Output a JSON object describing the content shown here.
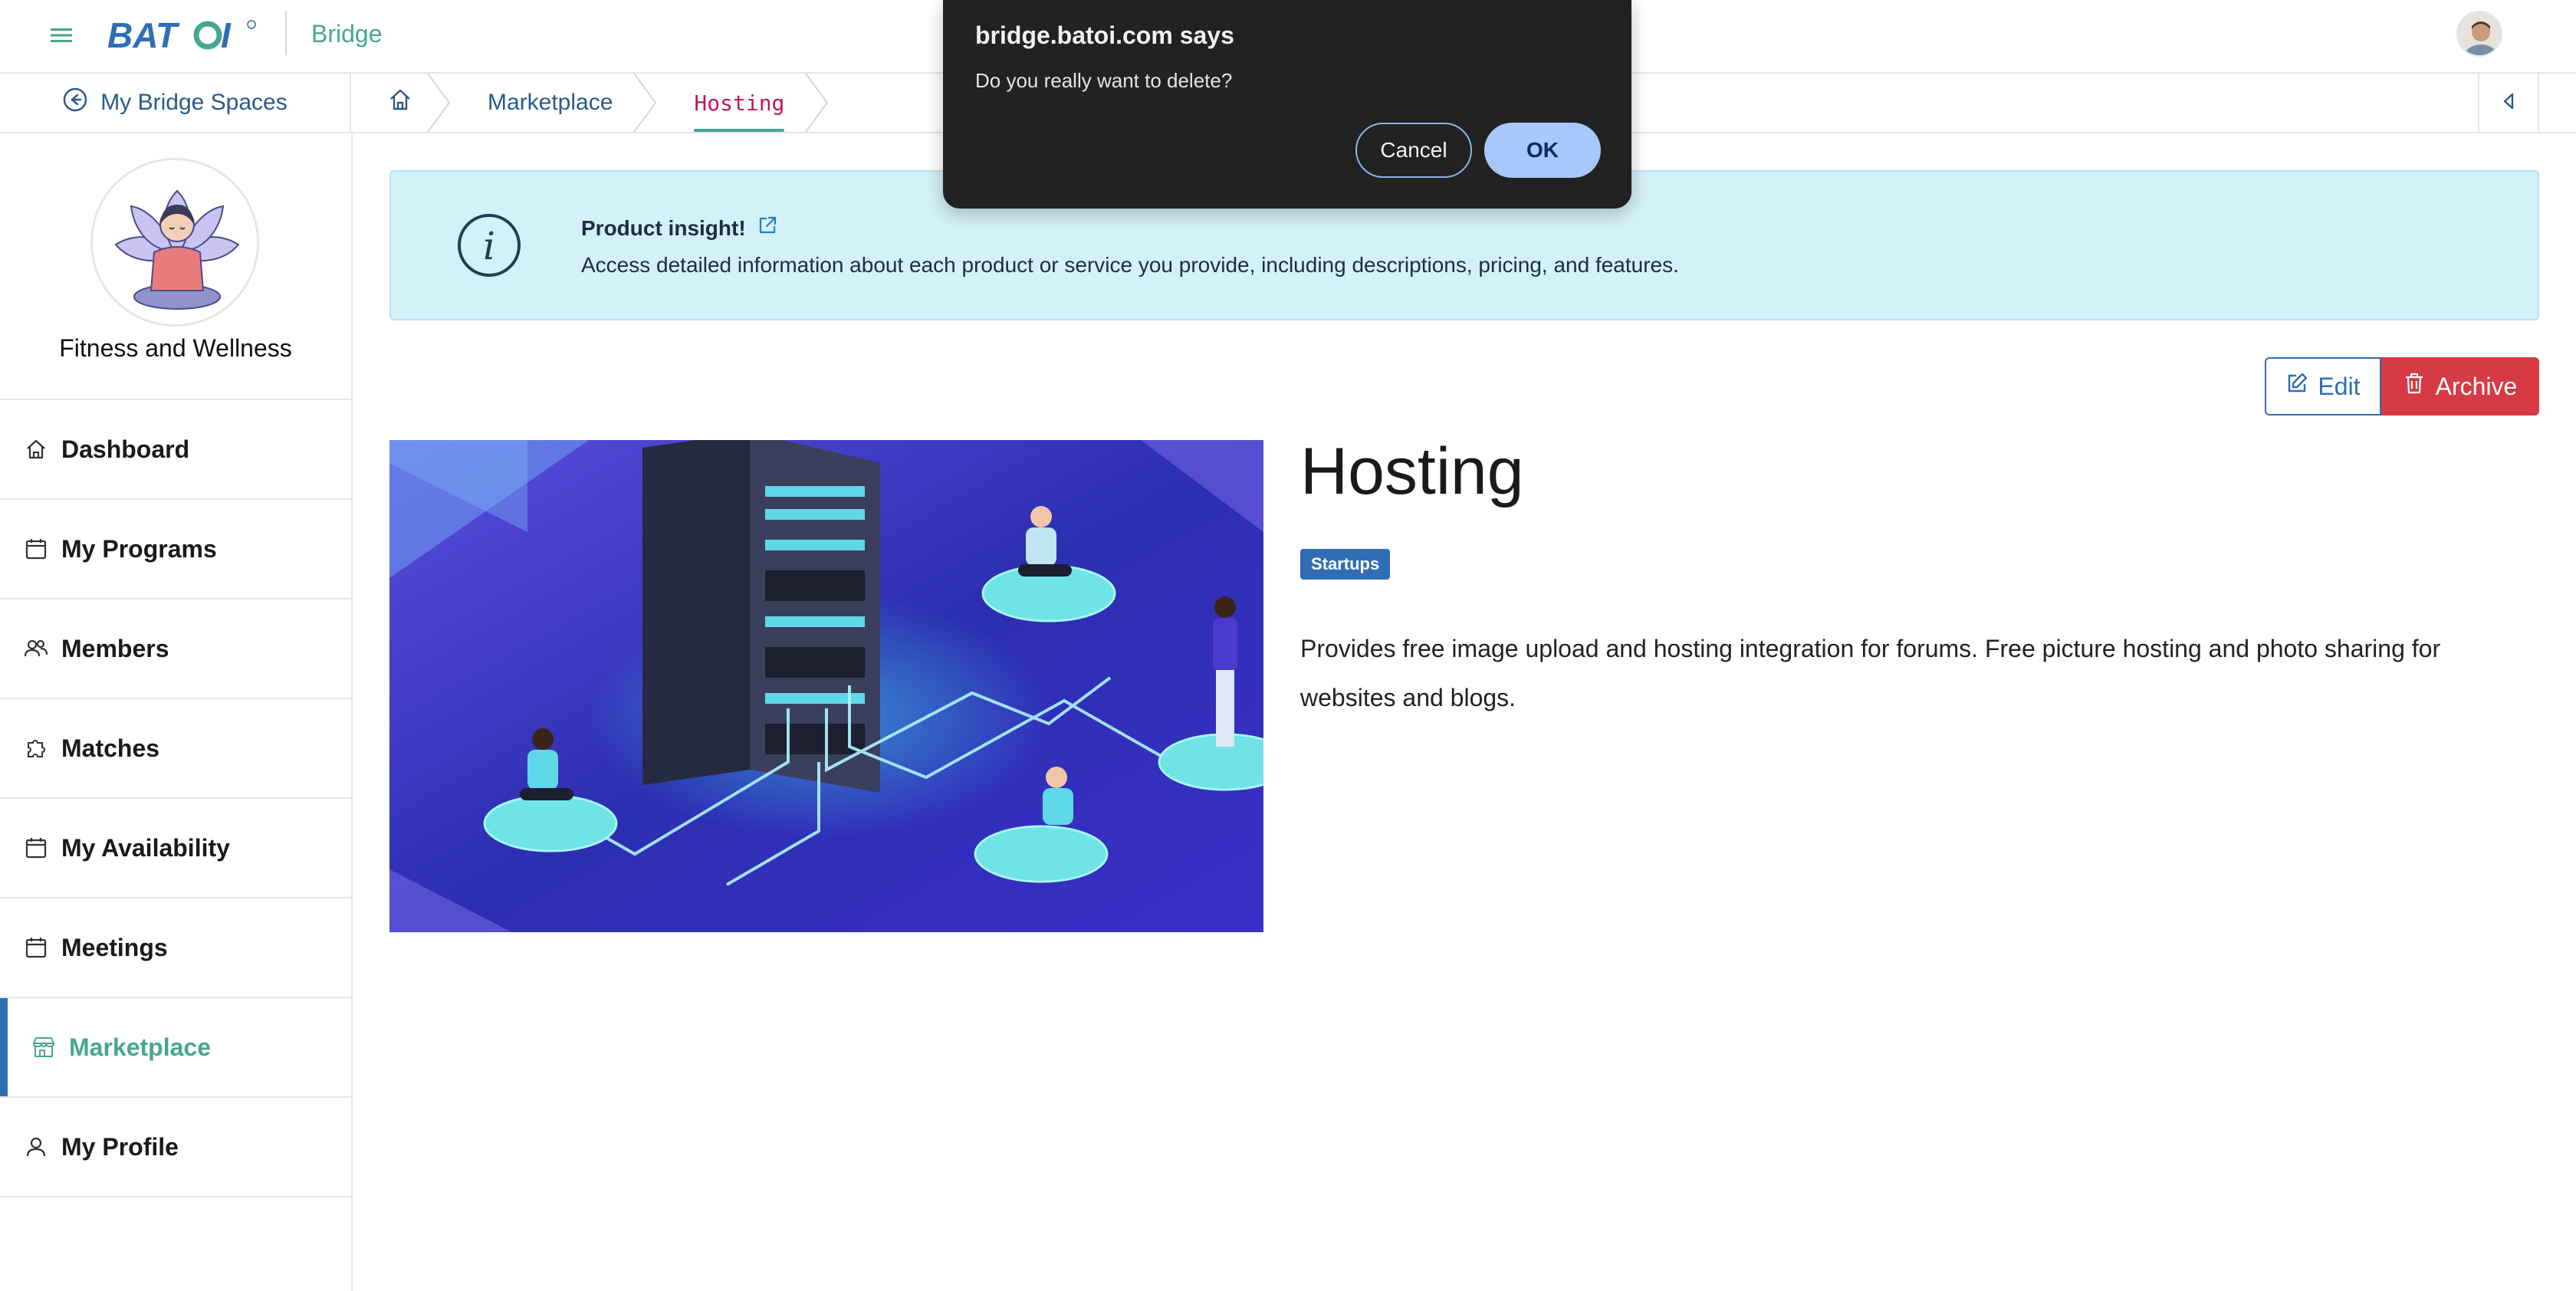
{
  "header": {
    "logo_text": "BATOI",
    "app_name": "Bridge"
  },
  "subheader": {
    "spaces_link": "My Bridge Spaces",
    "breadcrumbs": [
      {
        "label": "Marketplace"
      },
      {
        "label": "Hosting"
      }
    ]
  },
  "sidebar": {
    "space_name": "Fitness and Wellness",
    "items": [
      {
        "label": "Dashboard",
        "icon": "home-icon"
      },
      {
        "label": "My Programs",
        "icon": "calendar-icon"
      },
      {
        "label": "Members",
        "icon": "members-icon"
      },
      {
        "label": "Matches",
        "icon": "puzzle-icon"
      },
      {
        "label": "My Availability",
        "icon": "calendar-icon"
      },
      {
        "label": "Meetings",
        "icon": "calendar-icon"
      },
      {
        "label": "Marketplace",
        "icon": "store-icon",
        "active": true
      },
      {
        "label": "My Profile",
        "icon": "user-icon"
      }
    ]
  },
  "insight": {
    "title": "Product insight!",
    "description": "Access detailed information about each product or service you provide, including descriptions, pricing, and features."
  },
  "actions": {
    "edit_label": "Edit",
    "archive_label": "Archive"
  },
  "product": {
    "title": "Hosting",
    "tag": "Startups",
    "description": "Provides free image upload and hosting integration for forums. Free picture hosting and photo sharing for websites and blogs."
  },
  "dialog": {
    "title": "bridge.batoi.com says",
    "message": "Do you really want to delete?",
    "cancel_label": "Cancel",
    "ok_label": "OK"
  },
  "colors": {
    "brand_blue": "#2f6eb5",
    "brand_green": "#48a68f",
    "danger": "#d63a44",
    "insight_bg": "#d4f0f8",
    "dialog_bg": "#222222"
  }
}
